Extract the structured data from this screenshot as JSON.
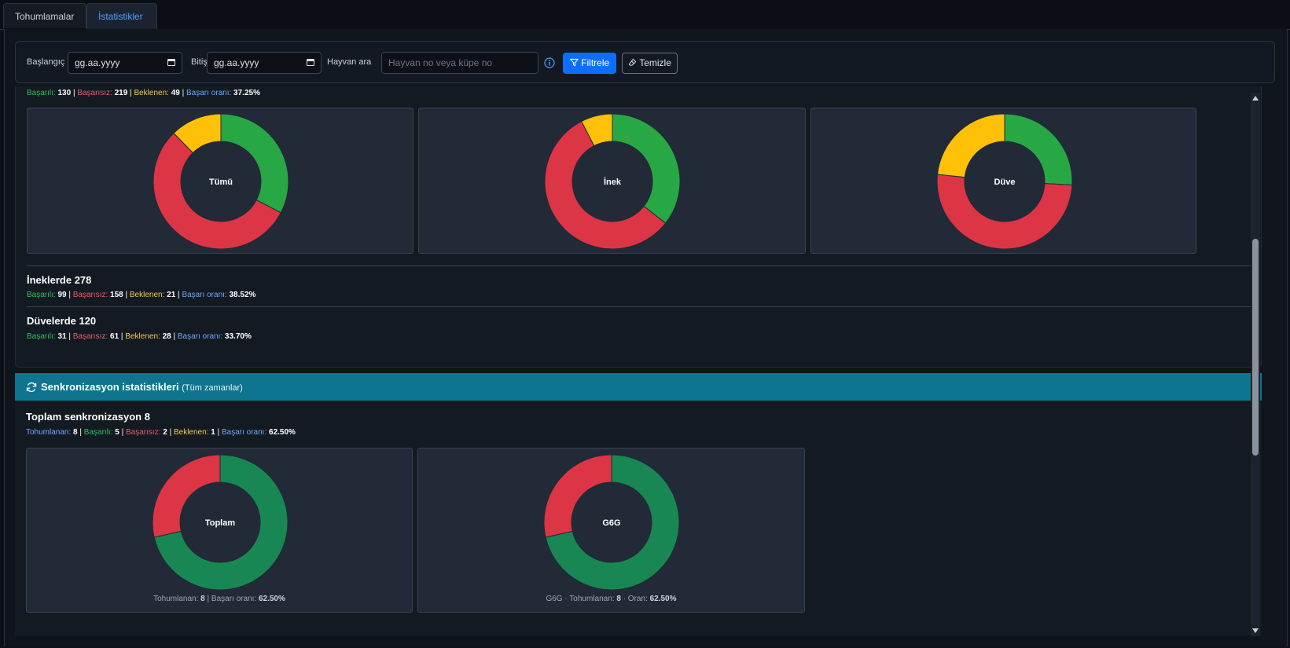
{
  "tabs": [
    {
      "label": "Tohumlamalar"
    },
    {
      "label": "İstatistikler"
    }
  ],
  "filters": {
    "start_label": "Başlangıç",
    "start_value": "gg.aa.yyyy",
    "end_label": "Bitiş",
    "end_value": "gg.aa.yyyy",
    "animal_label": "Hayvan ara",
    "animal_placeholder": "Hayvan no veya küpe no",
    "filter_button": "Filtrele",
    "clear_button": "Temizle"
  },
  "labels": {
    "basarili": "Başarılı:",
    "basarisiz": "Başarısız:",
    "beklenen": "Beklenen:",
    "basari_orani": "Başarı oranı:",
    "tohumlanan": "Tohumlanan:",
    "oran": "Oran:",
    "sep": "|"
  },
  "overall": {
    "basarili": "130",
    "basarisiz": "219",
    "beklenen": "49",
    "oran": "37.25%"
  },
  "donuts": [
    {
      "label": "Tümü",
      "values": [
        130,
        219,
        49
      ]
    },
    {
      "label": "İnek",
      "values": [
        99,
        158,
        21
      ]
    },
    {
      "label": "Düve",
      "values": [
        31,
        61,
        28
      ]
    }
  ],
  "inek_section": {
    "title": "İneklerde 278",
    "basarili": "99",
    "basarisiz": "158",
    "beklenen": "21",
    "oran": "38.52%"
  },
  "duve_section": {
    "title": "Düvelerde 120",
    "basarili": "31",
    "basarisiz": "61",
    "beklenen": "28",
    "oran": "33.70%"
  },
  "sync": {
    "header_title": "Senkronizasyon istatistikleri",
    "header_sub": "(Tüm zamanlar)",
    "total_title": "Toplam senkronizasyon 8",
    "tohumlanan": "8",
    "basarili": "5",
    "basarisiz": "2",
    "beklenen": "1",
    "oran": "62.50%",
    "donuts": [
      {
        "label": "Toplam",
        "values": [
          5,
          2
        ]
      },
      {
        "label": "G6G",
        "values": [
          5,
          2
        ]
      }
    ],
    "caption1": {
      "prefix": "Tohumlanan:",
      "tohumlanan": "8",
      "oran_label": "Başarı oranı:",
      "oran": "62.50%"
    },
    "caption2": {
      "prefix": "G6G · Tohumlanan:",
      "tohumlanan": "8",
      "oran_label": "· Oran:",
      "oran": "62.50%"
    }
  },
  "colors": {
    "success": "#28a745",
    "fail": "#dc3545",
    "pending": "#ffc107",
    "sync_success": "#198754",
    "accent": "#0d6efd",
    "sync_header": "#0f7490"
  },
  "chart_data": [
    {
      "type": "pie",
      "title": "Tümü",
      "categories": [
        "Başarılı",
        "Başarısız",
        "Beklenen"
      ],
      "values": [
        130,
        219,
        49
      ]
    },
    {
      "type": "pie",
      "title": "İnek",
      "categories": [
        "Başarılı",
        "Başarısız",
        "Beklenen"
      ],
      "values": [
        99,
        158,
        21
      ]
    },
    {
      "type": "pie",
      "title": "Düve",
      "categories": [
        "Başarılı",
        "Başarısız",
        "Beklenen"
      ],
      "values": [
        31,
        61,
        28
      ]
    },
    {
      "type": "pie",
      "title": "Toplam",
      "categories": [
        "Başarılı",
        "Başarısız"
      ],
      "values": [
        5,
        2
      ]
    },
    {
      "type": "pie",
      "title": "G6G",
      "categories": [
        "Başarılı",
        "Başarısız"
      ],
      "values": [
        5,
        2
      ]
    }
  ]
}
